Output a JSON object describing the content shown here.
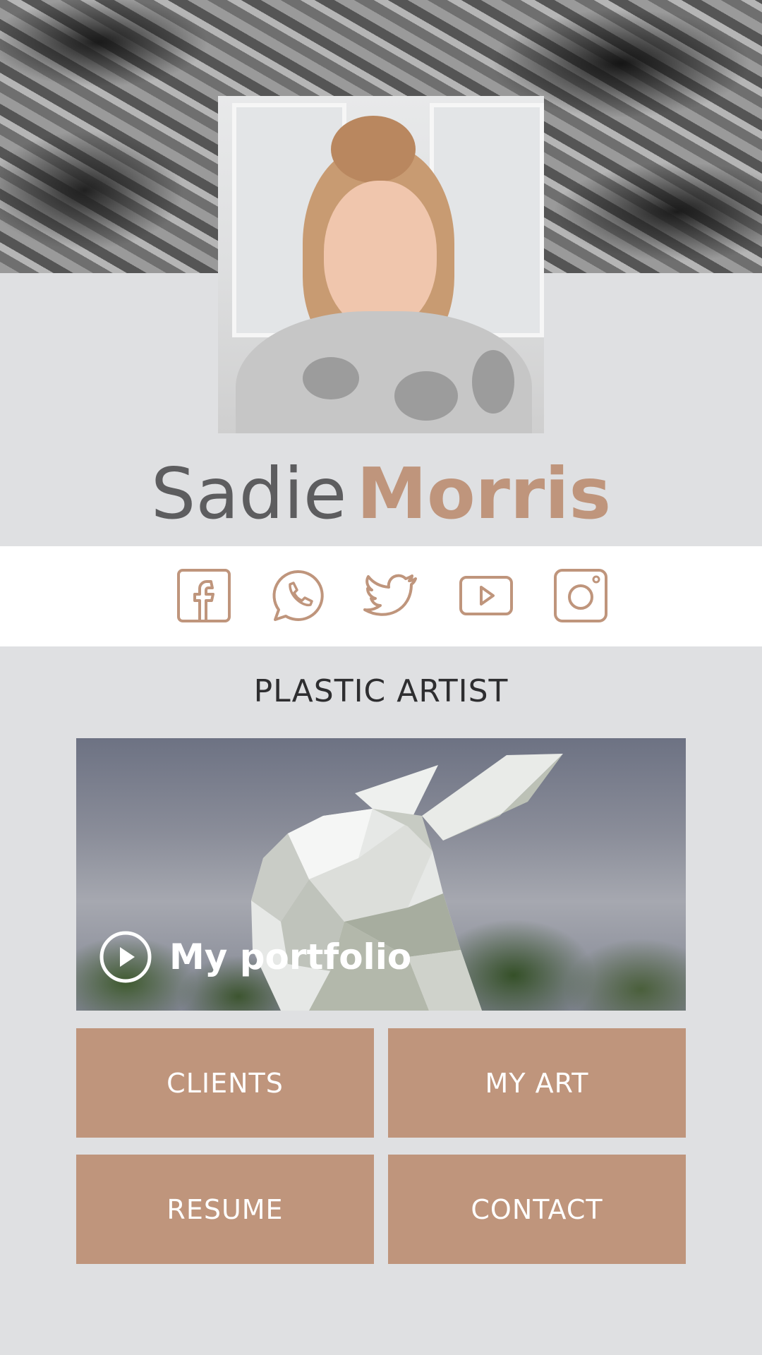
{
  "profile": {
    "first_name": "Sadie",
    "last_name": "Morris",
    "title": "PLASTIC ARTIST"
  },
  "social_icons": [
    "facebook-icon",
    "whatsapp-icon",
    "twitter-icon",
    "youtube-icon",
    "instagram-icon"
  ],
  "portfolio": {
    "label": "My portfolio"
  },
  "buttons": {
    "clients": "CLIENTS",
    "my_art": "MY ART",
    "resume": "RESUME",
    "contact": "CONTACT"
  },
  "colors": {
    "accent": "#bf957c",
    "background": "#dfe0e2",
    "name_dark": "#5d5d5f",
    "text_dark": "#2e2e30"
  }
}
